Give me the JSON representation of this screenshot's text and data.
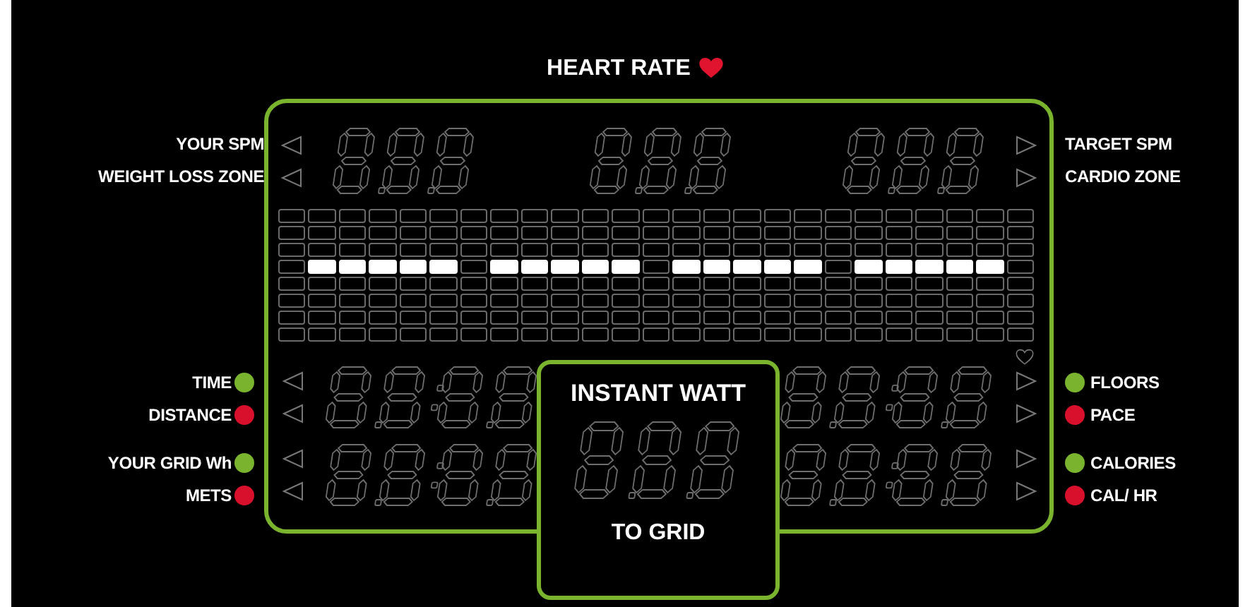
{
  "title": {
    "text": "HEART RATE"
  },
  "left_groups": [
    {
      "labels": [
        {
          "text": "YOUR SPM"
        },
        {
          "text": "WEIGHT LOSS ZONE"
        }
      ]
    },
    {
      "labels": [
        {
          "text": "TIME",
          "color": "#7ab32e"
        },
        {
          "text": "DISTANCE",
          "color": "#d9102c"
        }
      ]
    },
    {
      "labels": [
        {
          "text": "YOUR GRID Wh",
          "color": "#7ab32e"
        },
        {
          "text": "METS",
          "color": "#d9102c"
        }
      ]
    }
  ],
  "right_groups": [
    {
      "labels": [
        {
          "text": "TARGET SPM"
        },
        {
          "text": "CARDIO ZONE"
        }
      ]
    },
    {
      "labels": [
        {
          "text": "FLOORS",
          "color": "#7ab32e"
        },
        {
          "text": "PACE",
          "color": "#d9102c"
        }
      ]
    },
    {
      "labels": [
        {
          "text": "CALORIES",
          "color": "#7ab32e"
        },
        {
          "text": "CAL/ HR",
          "color": "#d9102c"
        }
      ]
    }
  ],
  "matrix": [
    [
      false,
      false,
      false,
      false,
      false,
      false,
      false,
      false,
      false,
      false,
      false,
      false,
      false,
      false,
      false,
      false,
      false,
      false,
      false,
      false,
      false,
      false,
      false,
      false,
      false
    ],
    [
      false,
      false,
      false,
      false,
      false,
      false,
      false,
      false,
      false,
      false,
      false,
      false,
      false,
      false,
      false,
      false,
      false,
      false,
      false,
      false,
      false,
      false,
      false,
      false,
      false
    ],
    [
      false,
      false,
      false,
      false,
      false,
      false,
      false,
      false,
      false,
      false,
      false,
      false,
      false,
      false,
      false,
      false,
      false,
      false,
      false,
      false,
      false,
      false,
      false,
      false,
      false
    ],
    [
      false,
      true,
      true,
      true,
      true,
      true,
      false,
      true,
      true,
      true,
      true,
      true,
      false,
      true,
      true,
      true,
      true,
      true,
      false,
      true,
      true,
      true,
      true,
      true,
      false
    ],
    [
      false,
      false,
      false,
      false,
      false,
      false,
      false,
      false,
      false,
      false,
      false,
      false,
      false,
      false,
      false,
      false,
      false,
      false,
      false,
      false,
      false,
      false,
      false,
      false,
      false
    ],
    [
      false,
      false,
      false,
      false,
      false,
      false,
      false,
      false,
      false,
      false,
      false,
      false,
      false,
      false,
      false,
      false,
      false,
      false,
      false,
      false,
      false,
      false,
      false,
      false,
      false
    ],
    [
      false,
      false,
      false,
      false,
      false,
      false,
      false,
      false,
      false,
      false,
      false,
      false,
      false,
      false,
      false,
      false,
      false,
      false,
      false,
      false,
      false,
      false,
      false,
      false,
      false
    ],
    [
      false,
      false,
      false,
      false,
      false,
      false,
      false,
      false,
      false,
      false,
      false,
      false,
      false,
      false,
      false,
      false,
      false,
      false,
      false,
      false,
      false,
      false,
      false,
      false,
      false
    ]
  ],
  "watt": {
    "title": "INSTANT WATT",
    "subtitle": "TO GRID"
  }
}
